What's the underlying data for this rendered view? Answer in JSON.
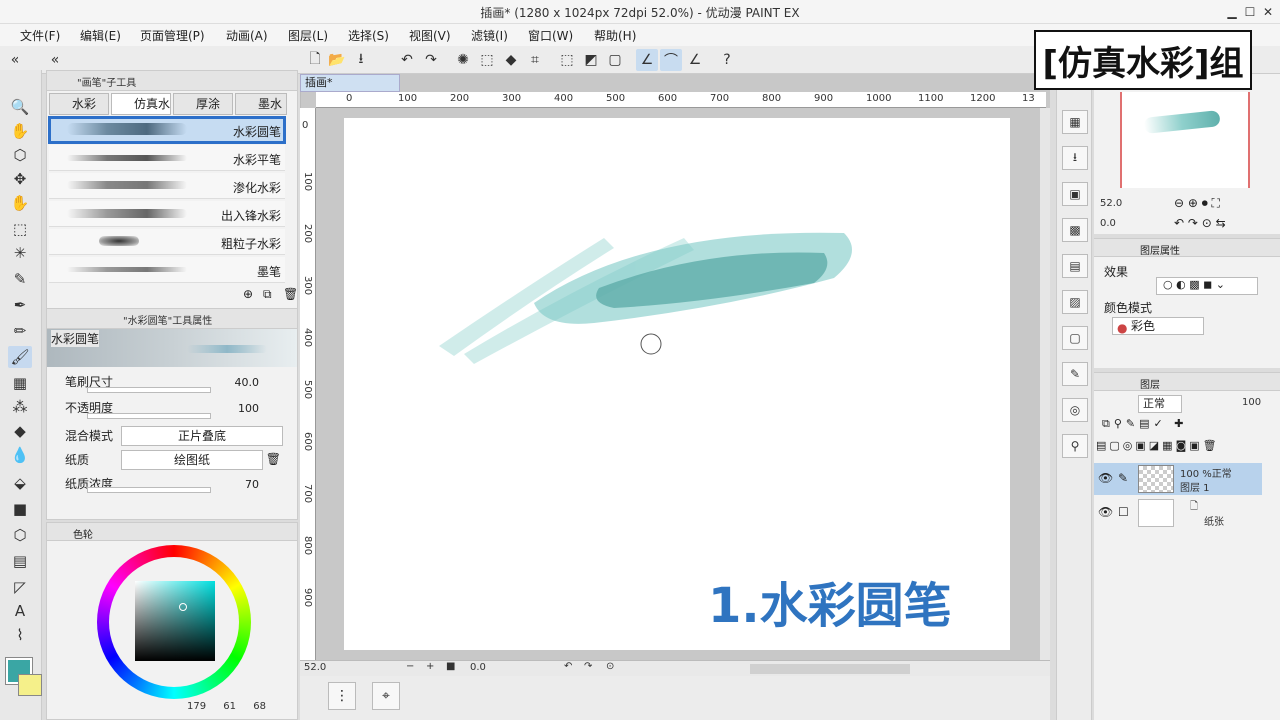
{
  "window": {
    "title": "插画* (1280 x 1024px 72dpi 52.0%) - 优动漫 PAINT EX"
  },
  "menu": [
    "文件(F)",
    "编辑(E)",
    "页面管理(P)",
    "动画(A)",
    "图层(L)",
    "选择(S)",
    "视图(V)",
    "滤镜(I)",
    "窗口(W)",
    "帮助(H)"
  ],
  "document_tab": "插画*",
  "subtool": {
    "header": "\"画笔\"子工具",
    "tabs": [
      "水彩",
      "仿真水",
      "厚涂",
      "墨水"
    ],
    "brushes": [
      "水彩圆笔",
      "水彩平笔",
      "渗化水彩",
      "出入锋水彩",
      "粗粒子水彩",
      "墨笔"
    ],
    "selected_index": 0
  },
  "tool_property": {
    "header": "\"水彩圆笔\"工具属性",
    "preview_label": "水彩圆笔",
    "rows": [
      {
        "label": "笔刷尺寸",
        "value": "40.0"
      },
      {
        "label": "不透明度",
        "value": "100"
      },
      {
        "label": "混合模式",
        "value": "正片叠底"
      },
      {
        "label": "纸质",
        "value": "绘图纸"
      },
      {
        "label": "纸质浓度",
        "value": "70"
      }
    ]
  },
  "color_panel": {
    "tab": "色轮",
    "readout": {
      "h": "179",
      "s": "61",
      "v": "68"
    },
    "main_color": "#3aa6a4",
    "sub_color": "#f5f08a"
  },
  "rulers": {
    "h": [
      "0",
      "100",
      "200",
      "300",
      "400",
      "500",
      "600",
      "700",
      "800",
      "900",
      "1000",
      "1100",
      "1200",
      "13"
    ],
    "v": [
      "0",
      "100",
      "200",
      "300",
      "400",
      "500",
      "600",
      "700",
      "800",
      "900"
    ]
  },
  "status": {
    "zoom": "52.0",
    "angle": "0.0"
  },
  "navigator": {
    "zoom": "52.0",
    "angle": "0.0"
  },
  "layer_property": {
    "tab": "图层属性",
    "effect_label": "效果",
    "color_mode_label": "颜色模式",
    "color_mode_value": "彩色"
  },
  "layers_panel": {
    "tab": "图层",
    "blend": "正常",
    "opacity": "100",
    "layers": [
      {
        "line1": "100 %正常",
        "line2": "图层 1",
        "selected": true
      },
      {
        "line1": "",
        "line2": "纸张",
        "selected": false
      }
    ]
  },
  "overlay_badge": "[仿真水彩]组",
  "overlay_label": "1.水彩圆笔"
}
